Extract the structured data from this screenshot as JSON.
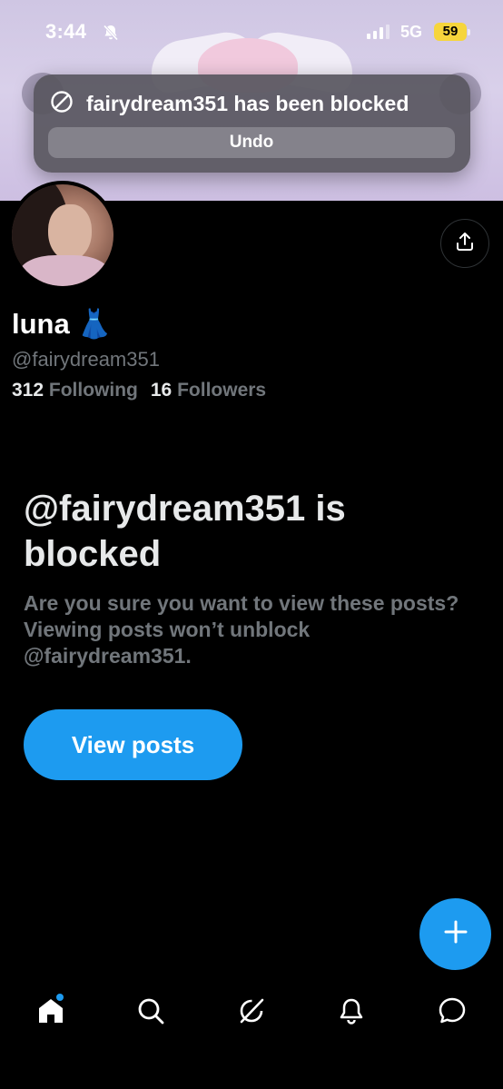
{
  "status_bar": {
    "time": "3:44",
    "network": "5G",
    "battery": "59"
  },
  "toast": {
    "message": "fairydream351 has been blocked",
    "undo_label": "Undo"
  },
  "profile": {
    "display_name": "luna",
    "name_emoji": "👗",
    "handle": "@fairydream351",
    "following_count": "312",
    "following_label": "Following",
    "followers_count": "16",
    "followers_label": "Followers"
  },
  "blocked_notice": {
    "title": "@fairydream351 is blocked",
    "description": "Are you sure you want to view these posts? Viewing posts won’t unblock @fairydream351.",
    "button_label": "View posts"
  },
  "colors": {
    "accent": "#1d9bf0",
    "background": "#000000",
    "muted_text": "#71767b",
    "battery": "#f6d53c"
  },
  "icons": {
    "status": [
      "bell-muted-icon",
      "signal-icon"
    ],
    "toast": "block-icon",
    "share": "share-icon",
    "fab": "plus-icon",
    "nav": [
      "home-icon",
      "search-icon",
      "grok-icon",
      "notifications-icon",
      "messages-icon"
    ]
  }
}
